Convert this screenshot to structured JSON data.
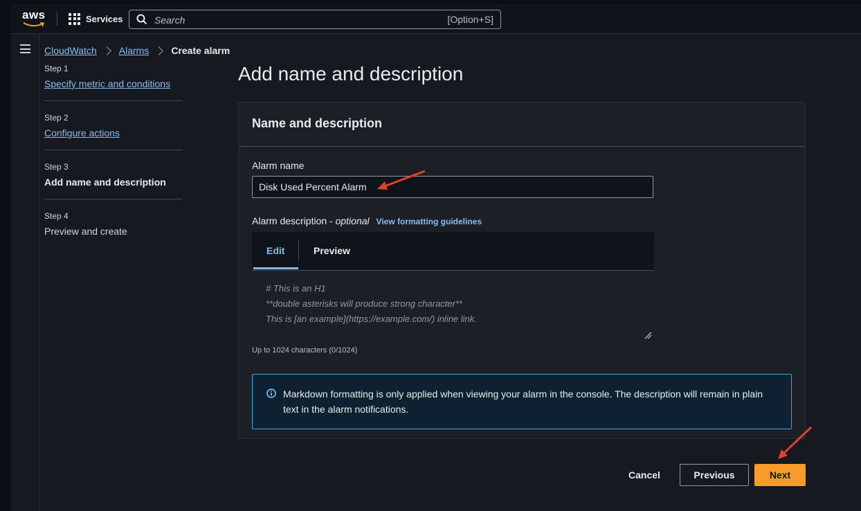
{
  "topnav": {
    "logo_text": "aws",
    "services_label": "Services",
    "search_placeholder": "Search",
    "search_shortcut": "[Option+S]"
  },
  "breadcrumb": {
    "items": [
      "CloudWatch",
      "Alarms"
    ],
    "current": "Create alarm"
  },
  "steps": [
    {
      "number": "Step 1",
      "label": "Specify metric and conditions",
      "state": "link"
    },
    {
      "number": "Step 2",
      "label": "Configure actions",
      "state": "link"
    },
    {
      "number": "Step 3",
      "label": "Add name and description",
      "state": "current"
    },
    {
      "number": "Step 4",
      "label": "Preview and create",
      "state": "disabled"
    }
  ],
  "main": {
    "title": "Add name and description",
    "panel_title": "Name and description",
    "alarm_name_label": "Alarm name",
    "alarm_name_value": "Disk Used Percent Alarm",
    "description_label": "Alarm description - ",
    "description_optional": "optional",
    "guidelines_link": "View formatting guidelines",
    "tabs": [
      "Edit",
      "Preview"
    ],
    "description_placeholder_lines": [
      "# This is an H1",
      "**double asterisks will produce strong character**",
      "This is [an example](https://example.com/) inline link."
    ],
    "char_count": "Up to 1024 characters (0/1024)",
    "info_text": "Markdown formatting is only applied when viewing your alarm in the console. The description will remain in plain text in the alarm notifications."
  },
  "footer": {
    "cancel": "Cancel",
    "previous": "Previous",
    "next": "Next"
  },
  "colors": {
    "accent": "#f89b2a",
    "link": "#89bdee",
    "annotation_arrow": "#e53e2b"
  }
}
